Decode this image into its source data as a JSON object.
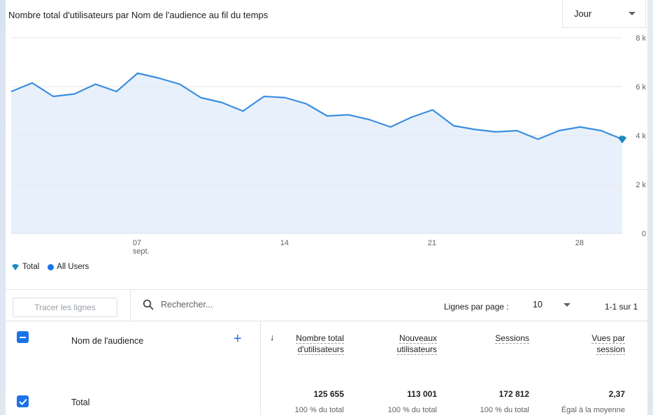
{
  "chart_title": "Nombre total d'utilisateurs par Nom de l'audience au fil du temps",
  "period_select": {
    "value": "Jour"
  },
  "legend": {
    "total": "Total",
    "all_users": "All Users"
  },
  "colors": {
    "accent": "#1a73e8",
    "line": "#3c8ede",
    "area": "#e8f1fb"
  },
  "chart_data": {
    "type": "area",
    "title": "Nombre total d'utilisateurs par Nom de l'audience au fil du temps",
    "x_ticks": [
      {
        "day": 7,
        "label": "07",
        "sublabel": "sept."
      },
      {
        "day": 14,
        "label": "14",
        "sublabel": ""
      },
      {
        "day": 21,
        "label": "21",
        "sublabel": ""
      },
      {
        "day": 28,
        "label": "28",
        "sublabel": ""
      }
    ],
    "y_ticks": [
      {
        "value": 0,
        "label": "0"
      },
      {
        "value": 2000,
        "label": "2 k"
      },
      {
        "value": 4000,
        "label": "4 k"
      },
      {
        "value": 6000,
        "label": "6 k"
      },
      {
        "value": 8000,
        "label": "8 k"
      }
    ],
    "ylim": [
      0,
      8000
    ],
    "xlim": [
      1,
      30
    ],
    "grid": true,
    "series": [
      {
        "name": "Total",
        "x": [
          1,
          2,
          3,
          4,
          5,
          6,
          7,
          8,
          9,
          10,
          11,
          12,
          13,
          14,
          15,
          16,
          17,
          18,
          19,
          20,
          21,
          22,
          23,
          24,
          25,
          26,
          27,
          28,
          29,
          30
        ],
        "values": [
          5800,
          6150,
          5600,
          5700,
          6100,
          5800,
          6550,
          6350,
          6100,
          5550,
          5350,
          5000,
          5600,
          5550,
          5300,
          4800,
          4850,
          4650,
          4350,
          4750,
          5050,
          4400,
          4250,
          4150,
          4200,
          3850,
          4200,
          4350,
          4200,
          3850
        ]
      }
    ]
  },
  "toolbar": {
    "trace_button": "Tracer les lignes",
    "search_placeholder": "Rechercher...",
    "rows_per_page_label": "Lignes par page :",
    "rows_per_page_value": "10",
    "pagination": "1-1 sur 1"
  },
  "table": {
    "dimension_header": "Nom de l'audience",
    "columns": [
      {
        "line1": "Nombre total",
        "line2": "d'utilisateurs",
        "value": "125 655",
        "sub": "100 % du total"
      },
      {
        "line1": "Nouveaux",
        "line2": "utilisateurs",
        "value": "113 001",
        "sub": "100 % du total"
      },
      {
        "line1": "Sessions",
        "line2": "",
        "value": "172 812",
        "sub": "100 % du total"
      },
      {
        "line1": "Vues par",
        "line2": "session",
        "value": "2,37",
        "sub": "Égal à la moyenne"
      }
    ],
    "row_label": "Total"
  }
}
